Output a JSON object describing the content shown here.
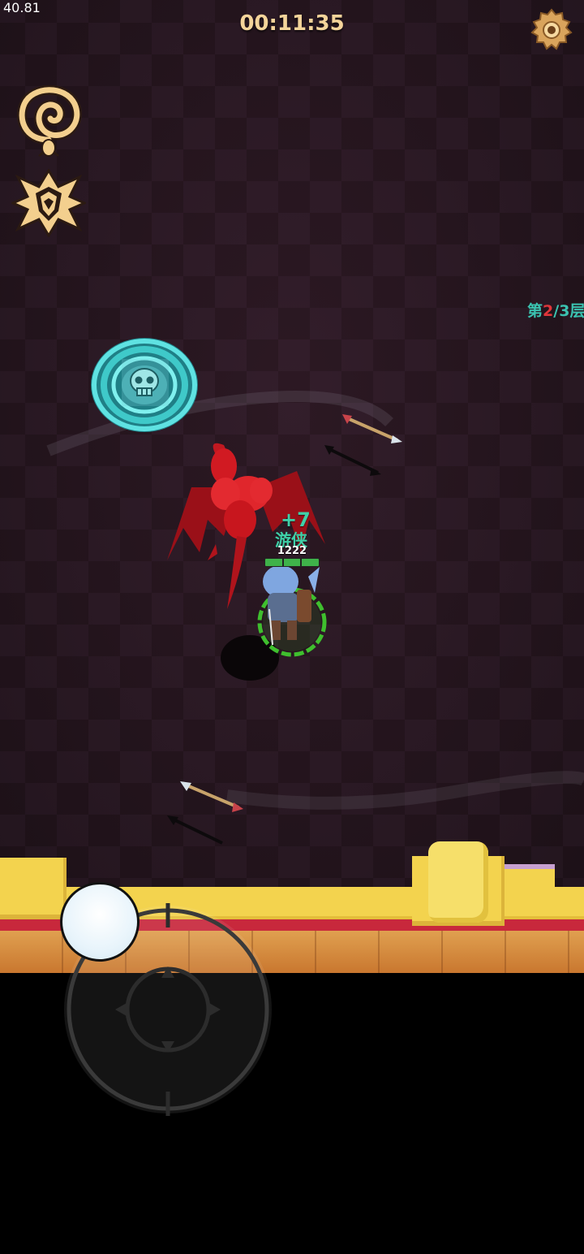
{
  "hud": {
    "fps": "40.81",
    "timer": "00:11:35",
    "floor_level": {
      "prefix": "第",
      "current": "2",
      "separator": "/",
      "total": "3",
      "suffix": "层"
    },
    "settings_icon": "gear-icon",
    "skill_icons": [
      "spiral-skill-icon",
      "wolf-emblem-skill-icon"
    ]
  },
  "hero": {
    "heal_popup": "+7",
    "name": "游侠",
    "hp": "1222",
    "hp_fraction": 1.0,
    "hp_segments": 3
  },
  "enemies": [
    {
      "type": "red-dragon"
    }
  ],
  "objects": [
    {
      "type": "skull-portal",
      "color": "#3fc9c9"
    }
  ],
  "colors": {
    "timer": "#f4d49a",
    "floor_level_text": "#3bc2b0",
    "floor_level_current": "#e0363a",
    "hero_name": "#3fd0a8",
    "dragon": "#d11a22",
    "hp_fill": "#3fb24a",
    "wall_top": "#f3d34e"
  },
  "controls": {
    "joystick": "virtual-joystick",
    "crosshair_icon": "crosshair-icon"
  }
}
